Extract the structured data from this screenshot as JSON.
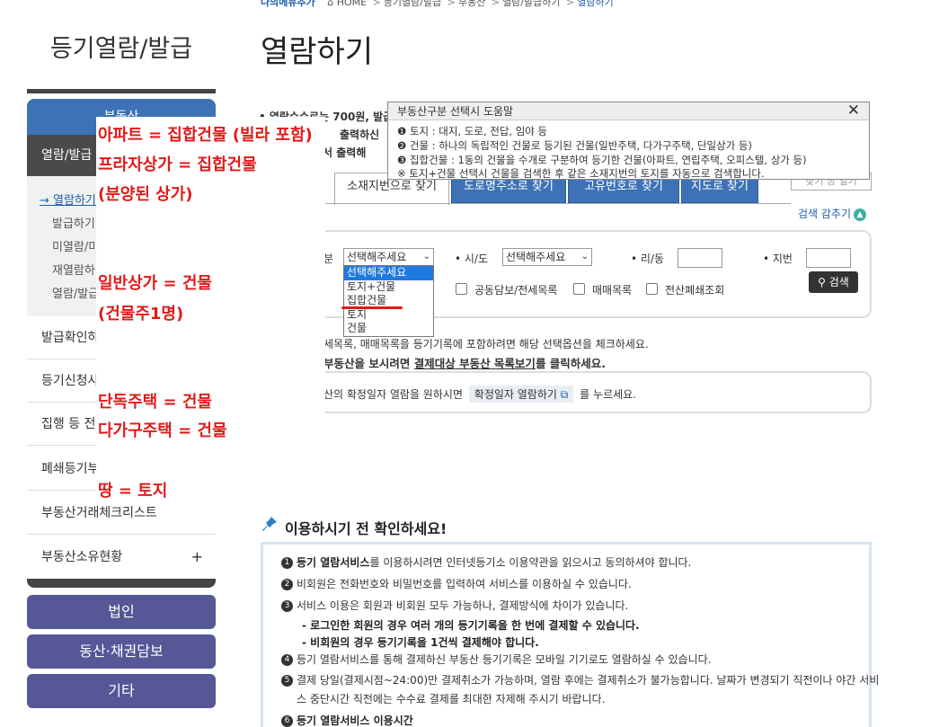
{
  "breadcrumb": {
    "home_tag": "나의메뉴추가",
    "home": "HOME",
    "path1": "등기열람/발급",
    "path2": "부동산",
    "path3": "열람/발급하기",
    "path4": "열람하기"
  },
  "sidebar": {
    "title": "등기열람/발급",
    "top_tab": "부동산",
    "dark_item": "열람/발급",
    "sub_items": [
      "→ 열람하기",
      "발급하기",
      "미열람/미",
      "재열람하",
      "열람/발급"
    ],
    "menus": [
      "발급확인하",
      "등기신청사",
      "집행 등 전",
      "폐쇄등기부",
      "부동산거래체크리스트",
      "부동산소유현황"
    ],
    "plus": "+",
    "buttons": [
      "법인",
      "동산·채권담보",
      "기타"
    ]
  },
  "annotations": [
    "아파트 = 집합건물 (빌라 포함)",
    "프라자상가 = 집합건물",
    "(분양된 상가)",
    "일반상가 = 건물",
    "(건물주1명)",
    "단독주택 = 건물",
    "다가구주택 = 건물",
    "땅 = 토지"
  ],
  "main": {
    "title": "열람하기",
    "notes": [
      "• 열람수수료는 700원, 발급",
      "출력하신",
      "에서 출력해"
    ],
    "tabs": [
      "소재지번으로 찾기",
      "도로명주소로 찾기",
      "고유번호로 찾기",
      "지도로 찾기"
    ],
    "extra_button": "찾기 창 열기",
    "hide_search": "검색 감추기",
    "form": {
      "label_type": "분",
      "select_type": "선택해주세요",
      "label_sido": "• 시/도",
      "select_sido": "선택해주세요",
      "label_ri": "• 리/동",
      "label_jibun": "• 지번",
      "check1": "공동담보/전세목록",
      "check2": "매매목록",
      "check3": "전산폐쇄조회",
      "search_button": "검색"
    },
    "dropdown_options": [
      "선택해주세요",
      "토지+건물",
      "집합건물",
      "토지",
      "건물"
    ],
    "note1": "세목록, 매매목록을 등기기록에 포함하려면 해당 선택옵션을 체크하세요.",
    "note2_a": "부동산을 보시려면",
    "note2_link": "결제대상 부동산 목록보기",
    "note2_b": "를 클릭하세요.",
    "date_a": "산의 확정일자 열람을 원하시면",
    "date_btn": "확정일자 열람하기",
    "date_b": "를 누르세요."
  },
  "help": {
    "title": "부동산구분 선택시 도움말",
    "close": "✕",
    "lines": [
      "❶ 토지 : 대지, 도로, 전답, 임야 등",
      "❷ 건물 : 하나의 독립적인 건물로 등기된 건물(일반주택, 다가구주택, 단일상가 등)",
      "❸ 집합건물 : 1동의 건물을 수개로 구분하여 등기한 건물(아파트, 연립주택, 오피스텔, 상가 등)",
      "※ 토지+건물 선택시 건물을 검색한 후 같은 소재지번의 토지를 자동으로 검색합니다."
    ]
  },
  "check": {
    "title": "이용하시기 전 확인하세요!",
    "lines": [
      {
        "num": "1",
        "bold": "등기 열람서비스",
        "text": "를 이용하시려면 인터넷등기소 이용약관을 읽으시고 동의하셔야 합니다."
      },
      {
        "num": "2",
        "bold": "",
        "text": "비회원은 전화번호와 비밀번호를 입력하여 서비스를 이용하실 수 있습니다."
      },
      {
        "num": "3",
        "bold": "",
        "text": "서비스 이용은 회원과 비회원 모두 가능하나, 결제방식에 차이가 있습니다."
      },
      {
        "num": "",
        "bold": "- 로그인한 회원의 경우 여러 개의 등기기록을 한 번에 결제할 수 있습니다.",
        "text": ""
      },
      {
        "num": "",
        "bold": "- 비회원의 경우 등기기록을 1건씩 결제해야 합니다.",
        "text": ""
      },
      {
        "num": "4",
        "bold": "",
        "text": "등기 열람서비스를 통해 결제하신 부동산 등기기록은 모바일 기기로도 열람하실 수 있습니다."
      },
      {
        "num": "5",
        "bold": "",
        "text": "결제 당일(결제시점~24:00)만 결제취소가 가능하며, 열람 후에는 결제취소가 불가능합니다. 날짜가 변경되기 직전이나 야간 서비"
      },
      {
        "num": "",
        "bold": "",
        "text": "스 중단시간 직전에는 수수료 결제를 최대한 자제해 주시기 바랍니다."
      },
      {
        "num": "6",
        "bold": "등기 열람서비스 이용시간",
        "text": ""
      }
    ]
  }
}
